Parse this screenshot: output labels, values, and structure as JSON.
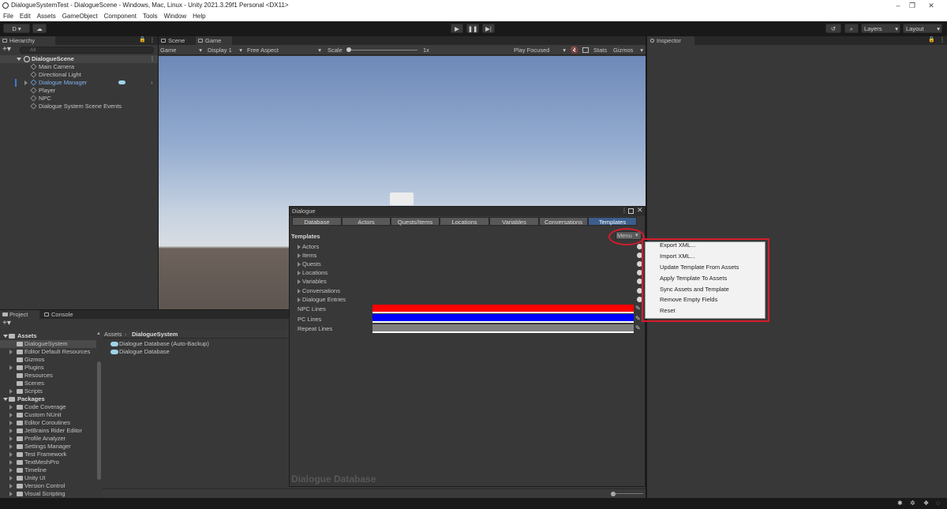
{
  "window": {
    "title": "DialogueSystemTest - DialogueScene - Windows, Mac, Linux - Unity 2021.3.29f1 Personal <DX11>",
    "controls": [
      "–",
      "❐",
      "✕"
    ]
  },
  "menubar": [
    "File",
    "Edit",
    "Assets",
    "GameObject",
    "Component",
    "Tools",
    "Window",
    "Help"
  ],
  "toolbar": {
    "account_label": "D ▾",
    "layers_label": "Layers",
    "layout_label": "Layout"
  },
  "hierarchy": {
    "tab": "Hierarchy",
    "search_placeholder": "All",
    "scene": "DialogueScene",
    "items": [
      "Main Camera",
      "Directional Light",
      "Dialogue Manager",
      "Player",
      "NPC",
      "Dialogue System Scene Events"
    ]
  },
  "scene_tabs": {
    "scene": "Scene",
    "game": "Game"
  },
  "game_toolbar": {
    "game_dropdown": "Game",
    "display": "Display 1",
    "aspect": "Free Aspect",
    "scale_label": "Scale",
    "scale_value": "1x",
    "play_focused": "Play Focused",
    "stats": "Stats",
    "gizmos": "Gizmos"
  },
  "inspector": {
    "tab": "Inspector"
  },
  "project": {
    "tabs": [
      "Project",
      "Console"
    ],
    "breadcrumb": [
      "Assets",
      "DialogueSystem"
    ],
    "tree": [
      {
        "label": "Assets",
        "bold": true
      },
      {
        "label": "DialogueSystem"
      },
      {
        "label": "Editor Default Resources"
      },
      {
        "label": "Gizmos"
      },
      {
        "label": "Plugins"
      },
      {
        "label": "Resources"
      },
      {
        "label": "Scenes"
      },
      {
        "label": "Scripts"
      },
      {
        "label": "Packages",
        "bold": true
      },
      {
        "label": "Code Coverage"
      },
      {
        "label": "Custom NUnit"
      },
      {
        "label": "Editor Coroutines"
      },
      {
        "label": "JetBrains Rider Editor"
      },
      {
        "label": "Profile Analyzer"
      },
      {
        "label": "Settings Manager"
      },
      {
        "label": "Test Framework"
      },
      {
        "label": "TextMeshPro"
      },
      {
        "label": "Timeline"
      },
      {
        "label": "Unity UI"
      },
      {
        "label": "Version Control"
      },
      {
        "label": "Visual Scripting"
      }
    ],
    "files": [
      "Dialogue Database (Auto-Backup)",
      "Dialogue Database"
    ]
  },
  "dialogue": {
    "window_title": "Dialogue",
    "tabs": [
      "Database",
      "Actors",
      "Quests/Items",
      "Locations",
      "Variables",
      "Conversations",
      "Templates"
    ],
    "active_tab": "Templates",
    "section_title": "Templates",
    "menu_button": "Menu",
    "foldouts": [
      "Actors",
      "Items",
      "Quests",
      "Locations",
      "Variables",
      "Conversations",
      "Dialogue Entries"
    ],
    "color_rows": [
      {
        "label": "NPC Lines",
        "color": "#ff0000"
      },
      {
        "label": "PC Lines",
        "color": "#0000ff"
      },
      {
        "label": "Repeat Lines",
        "color": "#808080"
      }
    ],
    "footer_watermark": "Dialogue Database"
  },
  "menu_popup": {
    "items": [
      "Export XML...",
      "Import XML...",
      "Update Template From Assets",
      "Apply Template To Assets",
      "Sync Assets and Template",
      "Remove Empty Fields",
      "Reset"
    ]
  },
  "colors": {
    "highlight_red": "#d41c2c",
    "selection_blue": "#3c5e8c",
    "panel": "#383838"
  }
}
